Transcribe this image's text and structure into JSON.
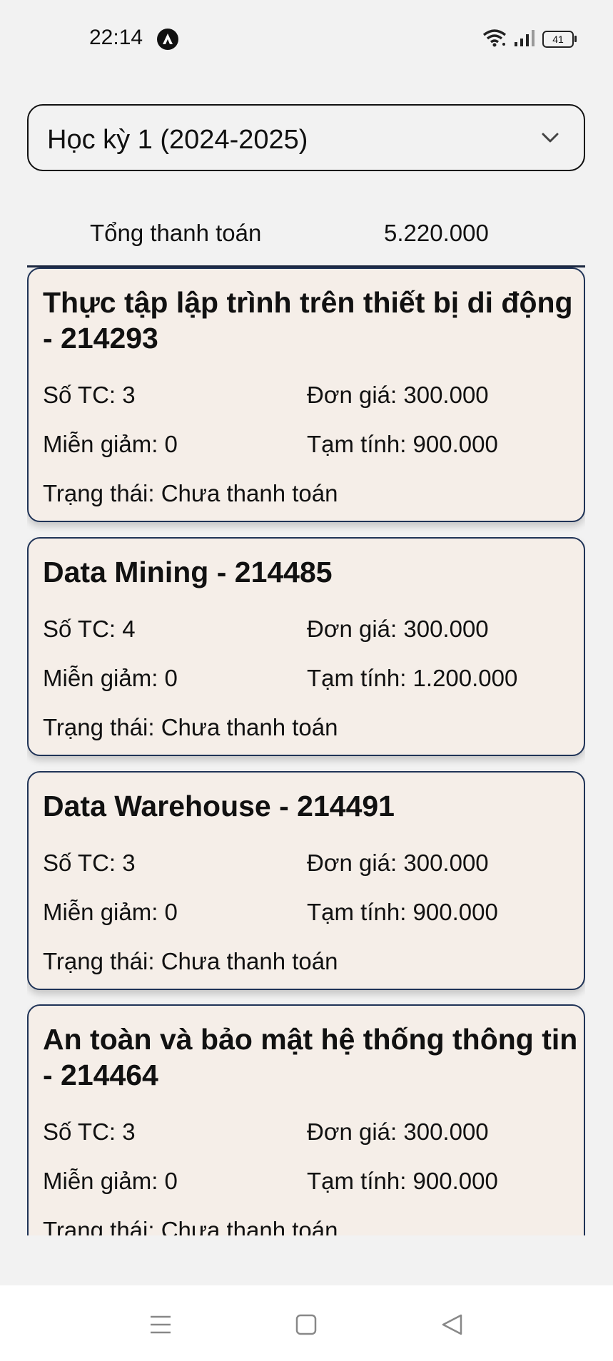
{
  "status_bar": {
    "time": "22:14",
    "battery": "41"
  },
  "semester": {
    "selected": "Học kỳ 1 (2024-2025)"
  },
  "total": {
    "label": "Tổng thanh toán",
    "value": "5.220.000"
  },
  "courses": [
    {
      "title": "Thực tập lập trình trên thiết bị di động - 214293",
      "credits": "Số TC: 3",
      "unit_price": "Đơn giá: 300.000",
      "discount": "Miễn giảm: 0",
      "subtotal": "Tạm tính: 900.000",
      "status": "Trạng thái: Chưa thanh toán"
    },
    {
      "title": "Data Mining - 214485",
      "credits": "Số TC: 4",
      "unit_price": "Đơn giá: 300.000",
      "discount": "Miễn giảm: 0",
      "subtotal": "Tạm tính: 1.200.000",
      "status": "Trạng thái: Chưa thanh toán"
    },
    {
      "title": "Data Warehouse - 214491",
      "credits": "Số TC: 3",
      "unit_price": "Đơn giá: 300.000",
      "discount": "Miễn giảm: 0",
      "subtotal": "Tạm tính: 900.000",
      "status": "Trạng thái: Chưa thanh toán"
    },
    {
      "title": "An toàn và bảo mật hệ thống thông tin - 214464",
      "credits": "Số TC: 3",
      "unit_price": "Đơn giá: 300.000",
      "discount": "Miễn giảm: 0",
      "subtotal": "Tạm tính: 900.000",
      "status": "Trạng thái: Chưa thanh toán"
    }
  ],
  "icons": {
    "status_app": "app-notification-icon",
    "wifi": "wifi-icon",
    "signal": "signal-icon",
    "battery": "battery-icon",
    "dropdown": "chevron-down-icon",
    "nav_menu": "menu-icon",
    "nav_home": "home-square-icon",
    "nav_back": "back-triangle-icon"
  }
}
